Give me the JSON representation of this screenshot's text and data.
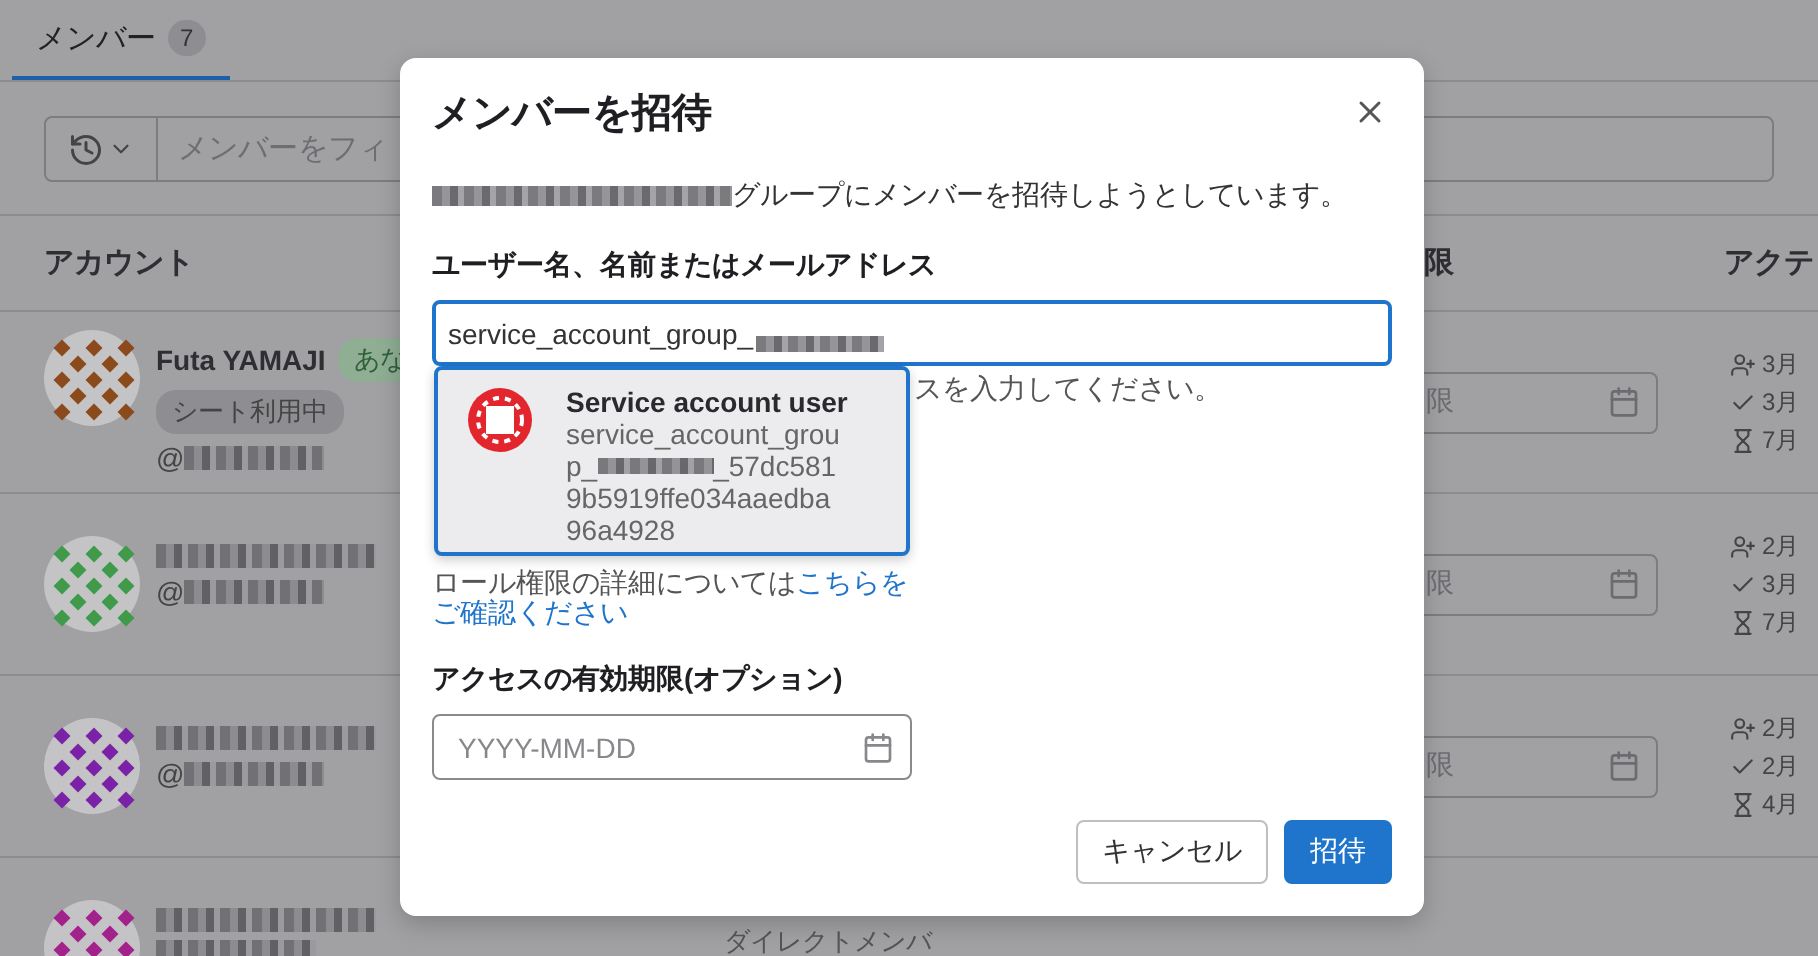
{
  "tabs": [
    {
      "label": "メンバー",
      "count": "7",
      "selected": true
    }
  ],
  "filter": {
    "placeholder": "メンバーをフィ"
  },
  "table": {
    "columns": [
      "アカウント",
      "限",
      "アクテ"
    ],
    "rows": [
      {
        "color": "#8a4a1c",
        "name": "Futa YAMAJI",
        "badges": [
          {
            "label": "あな",
            "kind": "you"
          },
          {
            "label": "シート利用中",
            "kind": "seat"
          }
        ],
        "handle": "@",
        "expiry_placeholder": "限",
        "activity": [
          "3月",
          "3月",
          "7月"
        ]
      },
      {
        "color": "#3f9a4a",
        "handle": "@",
        "expiry_placeholder": "限",
        "activity": [
          "2月",
          "3月",
          "7月"
        ]
      },
      {
        "color": "#7a22a6",
        "handle": "@",
        "expiry_placeholder": "限",
        "activity": [
          "2月",
          "2月",
          "4月"
        ]
      },
      {
        "color": "#a0228a",
        "source": "ダイレクトメンバ"
      }
    ]
  },
  "modal": {
    "title": "メンバーを招待",
    "intro": "グループにメンバーを招待しようとしています。",
    "username_label": "ユーザー名、名前またはメールアドレス",
    "username_value": "service_account_group_",
    "username_help": "スを入力してください。",
    "suggestion": {
      "title": "Service account user",
      "lines": [
        {
          "parts": [
            "service_account_grou"
          ]
        },
        {
          "parts": [
            "p_",
            "_57dc581"
          ]
        },
        {
          "parts": [
            "9b5919ffe034aaedba"
          ]
        },
        {
          "parts": [
            "96a4928"
          ]
        }
      ],
      "selected": true
    },
    "role_note": {
      "text": "ロール権限の詳細については",
      "link_lines": [
        "こちらを",
        "ご確認ください"
      ]
    },
    "expiry_label": "アクセスの有効期限(オプション)",
    "expiry_placeholder": "YYYY-MM-DD",
    "buttons": [
      {
        "label": "キャンセル",
        "kind": "secondary"
      },
      {
        "label": "招待",
        "kind": "primary"
      }
    ]
  }
}
